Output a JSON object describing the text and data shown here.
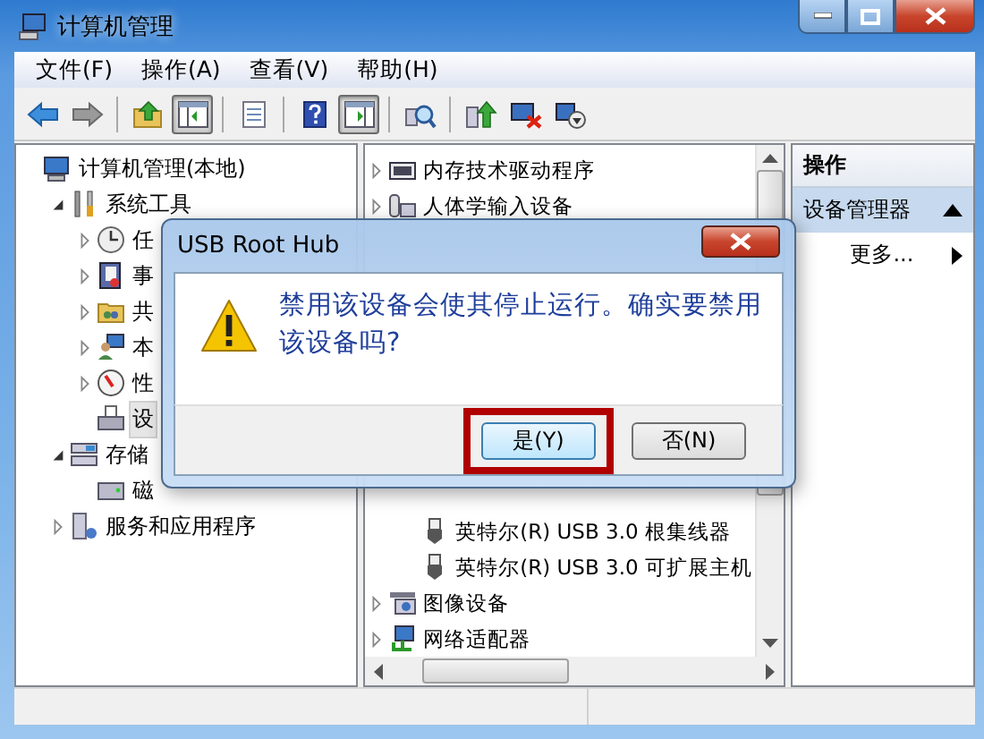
{
  "window": {
    "title": "计算机管理"
  },
  "menu": [
    "文件(F)",
    "操作(A)",
    "查看(V)",
    "帮助(H)"
  ],
  "toolbar": [
    {
      "kind": "back",
      "pressed": false,
      "disabled": false
    },
    {
      "kind": "forward",
      "pressed": false,
      "disabled": true
    },
    {
      "kind": "separator"
    },
    {
      "kind": "up",
      "pressed": false
    },
    {
      "kind": "tree",
      "pressed": true
    },
    {
      "kind": "separator"
    },
    {
      "kind": "properties",
      "pressed": false
    },
    {
      "kind": "separator"
    },
    {
      "kind": "help",
      "pressed": false
    },
    {
      "kind": "actionpane",
      "pressed": true
    },
    {
      "kind": "separator"
    },
    {
      "kind": "scan",
      "pressed": false
    },
    {
      "kind": "separator"
    },
    {
      "kind": "update",
      "pressed": false
    },
    {
      "kind": "disable",
      "pressed": false
    },
    {
      "kind": "uninstall",
      "pressed": false
    }
  ],
  "console_tree": {
    "items": [
      {
        "label": "计算机管理(本地)",
        "kind": "computer",
        "selected": false,
        "children": [
          {
            "label": "系统工具",
            "kind": "tools",
            "expanded": true,
            "selected": false,
            "children": [
              {
                "label": "任",
                "kind": "clock",
                "expanded": false,
                "selected": false
              },
              {
                "label": "事",
                "kind": "log",
                "expanded": false,
                "selected": false
              },
              {
                "label": "共",
                "kind": "share",
                "expanded": false,
                "selected": false
              },
              {
                "label": "本",
                "kind": "users",
                "expanded": false,
                "selected": false
              },
              {
                "label": "性",
                "kind": "perf",
                "expanded": false,
                "selected": false
              },
              {
                "label": "设",
                "kind": "device",
                "selected": true
              }
            ]
          },
          {
            "label": "存储",
            "kind": "storage",
            "expanded": true,
            "selected": false,
            "children": [
              {
                "label": "磁",
                "kind": "disk",
                "selected": false
              }
            ]
          },
          {
            "label": "服务和应用程序",
            "kind": "services",
            "expanded": false,
            "selected": false
          }
        ]
      }
    ]
  },
  "device_list": {
    "items": [
      {
        "label": "内存技术驱动程序",
        "kind": "memory",
        "expanded": false
      },
      {
        "label": "人体学输入设备",
        "kind": "hid",
        "expanded": false
      },
      {
        "kind": "covered",
        "children": [
          {
            "label": "英特尔(R) USB 3.0 根集线器",
            "kind": "usb"
          },
          {
            "label": "英特尔(R) USB 3.0 可扩展主机",
            "kind": "usb"
          }
        ]
      },
      {
        "label": "图像设备",
        "kind": "camera",
        "expanded": false
      },
      {
        "label": "网络适配器",
        "kind": "network",
        "expanded": false
      }
    ]
  },
  "actions": {
    "title": "操作",
    "section": {
      "label": "设备管理器",
      "expanded": true
    },
    "items": [
      "更多..."
    ]
  },
  "dialog": {
    "title": "USB Root Hub",
    "message": "禁用该设备会使其停止运行。确实要禁用该设备吗?",
    "buttons": [
      {
        "label": "是(Y)",
        "highlighted": true,
        "default": true
      },
      {
        "label": "否(N)",
        "highlighted": false,
        "default": false
      }
    ]
  }
}
